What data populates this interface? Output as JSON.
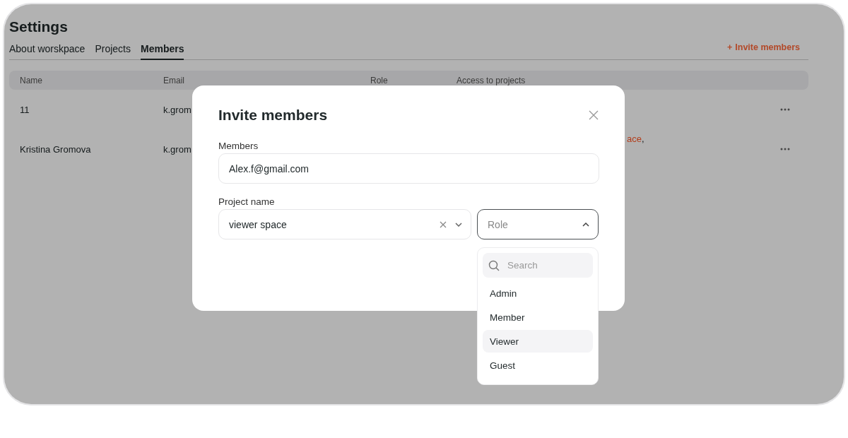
{
  "page": {
    "title": "Settings"
  },
  "tabs": [
    {
      "label": "About worskpace",
      "selected": false
    },
    {
      "label": "Projects",
      "selected": false
    },
    {
      "label": "Members",
      "selected": true
    }
  ],
  "invite_button": {
    "icon": "+",
    "label": "Invite members"
  },
  "table": {
    "columns": [
      "Name",
      "Email",
      "Role",
      "Access to projects"
    ],
    "rows": [
      {
        "name": "11",
        "email": "k.grom",
        "access": []
      },
      {
        "name": "Kristina Gromova",
        "email": "k.grom",
        "access": [
          {
            "text": "ace",
            "link": true
          },
          {
            "text": ",",
            "link": false
          }
        ]
      }
    ]
  },
  "modal": {
    "title": "Invite members",
    "members_label": "Members",
    "members_value": "Alex.f@gmail.com",
    "project_label": "Project name",
    "project_value": "viewer space",
    "role_placeholder": "Role",
    "role_expanded": true,
    "search_placeholder": "Search",
    "roles": [
      {
        "label": "Admin",
        "selected": false
      },
      {
        "label": "Member",
        "selected": false
      },
      {
        "label": "Viewer",
        "selected": true
      },
      {
        "label": "Guest",
        "selected": false
      }
    ]
  }
}
